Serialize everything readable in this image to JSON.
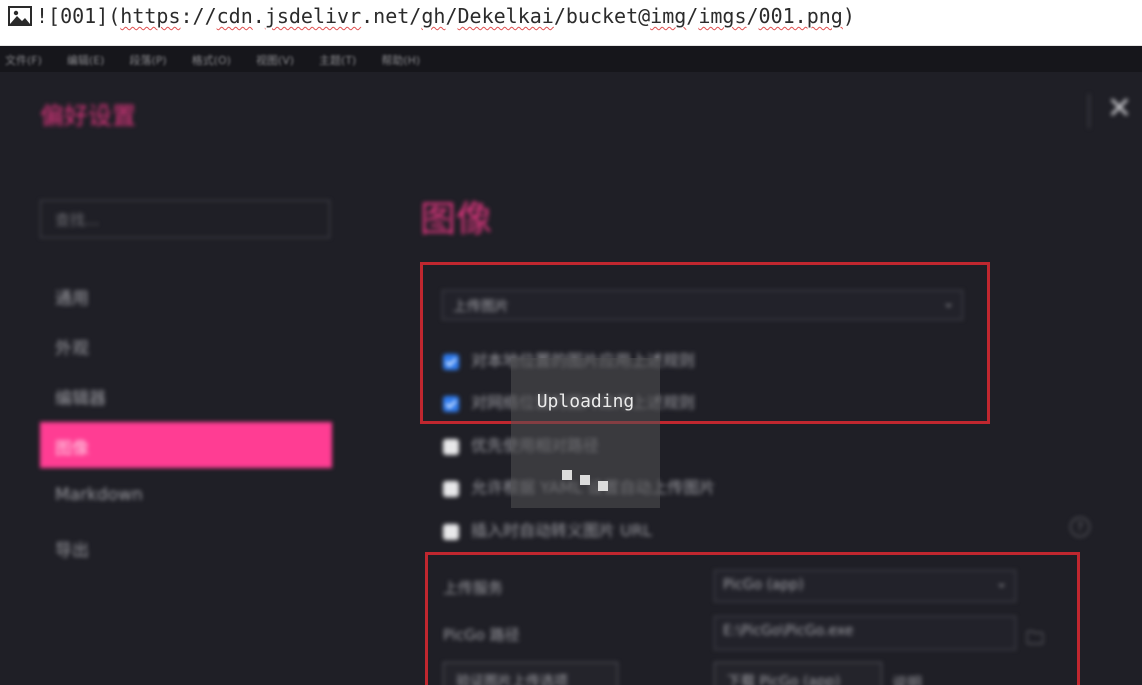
{
  "editor": {
    "markdown_bang": "![001](",
    "url_parts": [
      "https",
      "://",
      "cdn",
      ".",
      "jsdelivr",
      ".net/",
      "gh",
      "/",
      "Dekelkai",
      "/bucket@",
      "img",
      "/",
      "imgs",
      "/",
      "001.png",
      ")"
    ]
  },
  "menubar": {
    "items": [
      "文件(F)",
      "编辑(E)",
      "段落(P)",
      "格式(O)",
      "视图(V)",
      "主题(T)",
      "帮助(H)"
    ]
  },
  "prefs": {
    "title": "偏好设置",
    "search_placeholder": "查找...",
    "nav": [
      "通用",
      "外观",
      "编辑器",
      "图像",
      "Markdown",
      "导出"
    ],
    "active_nav": "图像",
    "content_title": "图像",
    "insert_action": "上传图片",
    "options": [
      {
        "label": "对本地位置的图片应用上述规则",
        "checked": true
      },
      {
        "label": "对网络位置的图片应用上述规则",
        "checked": true
      },
      {
        "label": "优先使用相对路径",
        "checked": false
      },
      {
        "label": "允许根据 YAML 设置自动上传图片",
        "checked": false
      },
      {
        "label": "插入时自动转义图片 URL",
        "checked": false
      }
    ],
    "upload_service_label": "上传服务",
    "upload_service_value": "PicGo (app)",
    "picgo_path_label": "PicGo 路径",
    "picgo_path_value": "E:\\PicGo\\PicGo.exe",
    "verify_button": "验证图片上传选项",
    "download_button": "下载 PicGo (app)",
    "tail_text": "说明"
  },
  "overlay": {
    "text": "Uploading"
  }
}
